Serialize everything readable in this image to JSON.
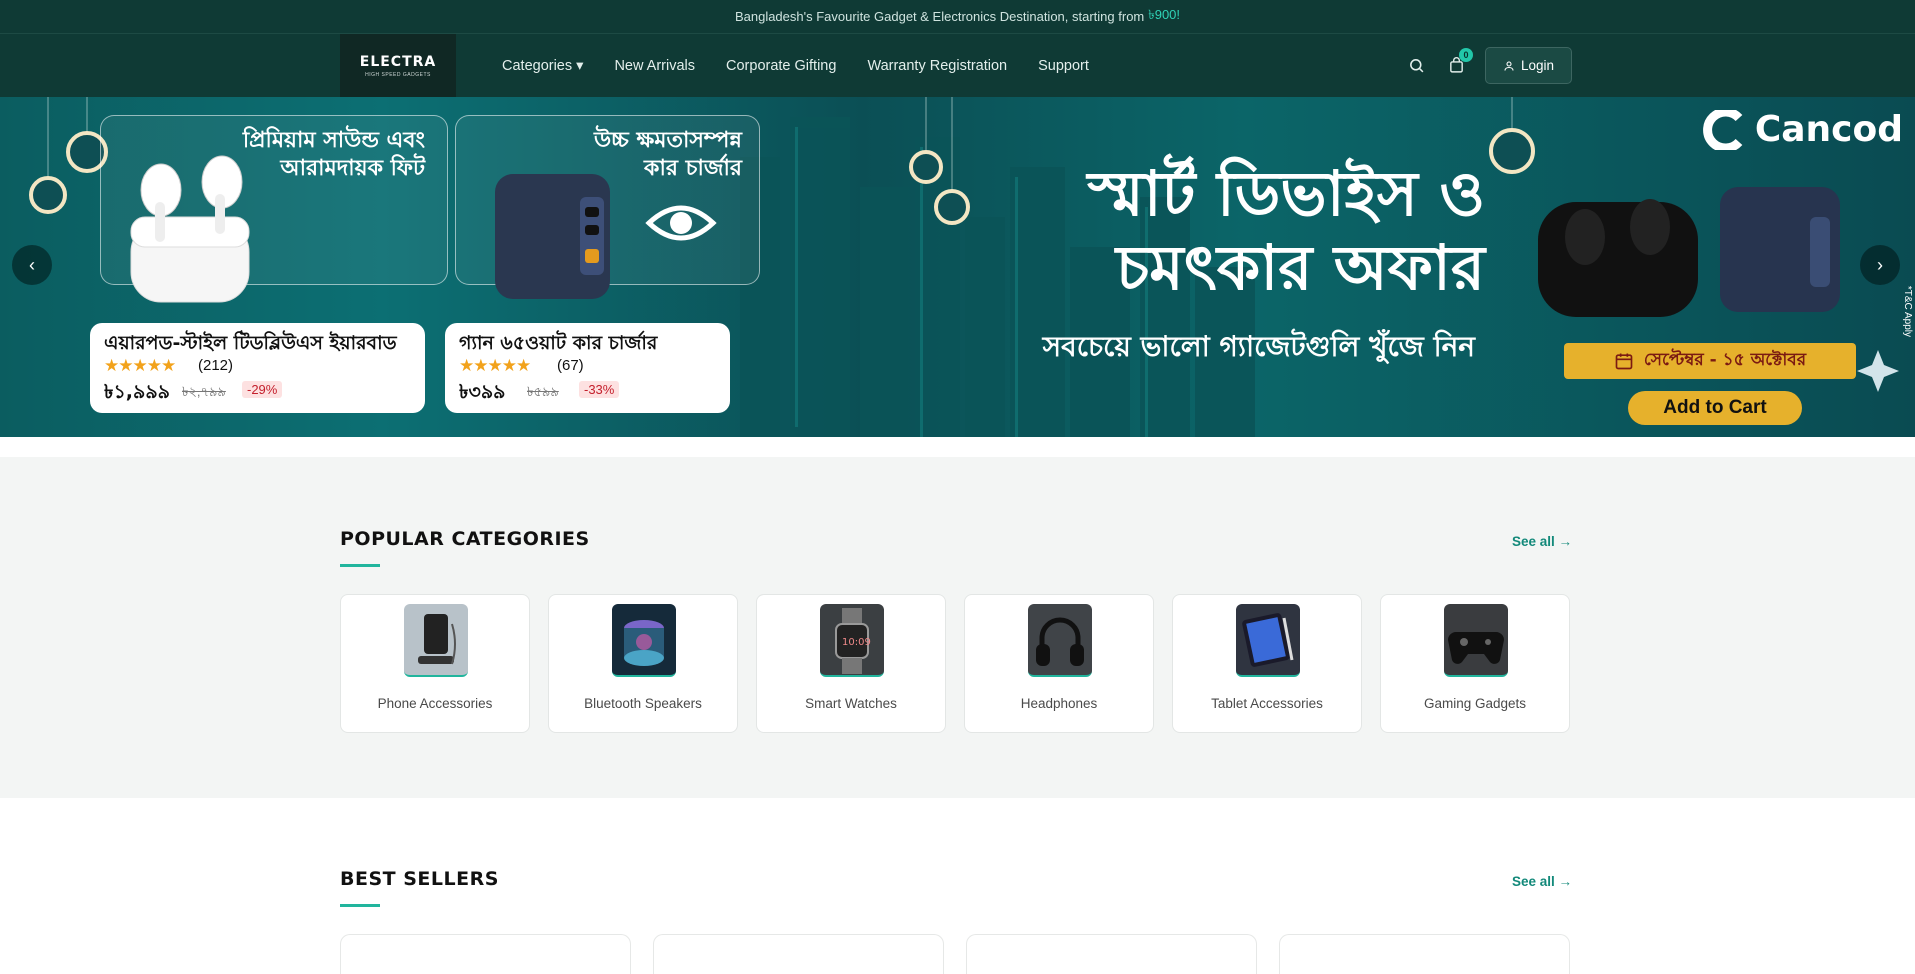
{
  "announcement": {
    "text": "Bangladesh's Favourite Gadget & Electronics Destination, starting from",
    "price": "৳900!"
  },
  "nav": {
    "logo": "ELECTRA",
    "logo_tagline": "HIGH SPEED GADGETS",
    "menu": [
      "Categories ▾",
      "New Arrivals",
      "Corporate Gifting",
      "Warranty Registration",
      "Support"
    ],
    "cart_count": "0",
    "login_label": "Login"
  },
  "hero": {
    "card1": {
      "heading": [
        "প্রিমিয়াম সাউন্ড এবং",
        "আরামদায়ক ফিট"
      ],
      "title": "এয়ারপড-স্টাইল টিডব্লিউএস ইয়ারবাড",
      "rating": 4.5,
      "stars": "★★★★★",
      "reviews": "(212)",
      "price": "৳১,৯৯৯",
      "old_price": "৳২,৭৯৯",
      "discount": "-29%"
    },
    "card2": {
      "heading": [
        "উচ্চ ক্ষমতাসম্পন্ন",
        "কার চার্জার"
      ],
      "title": "গ্যান ৬৫ওয়াট কার চার্জার",
      "rating": 4.5,
      "stars": "★★★★★",
      "reviews": "(67)",
      "price": "৳৩৯৯",
      "old_price": "৳৫৯৯",
      "discount": "-33%"
    },
    "headline_1": "স্মার্ট ডিভাইস ও",
    "headline_2": "চমৎকার অফার",
    "subline": "সবচেয়ে ভালো গ্যাজেটগুলি খুঁজে নিন",
    "brand": "Cancod",
    "date_ribbon": "সেপ্টেম্বর - ১৫ অক্টোবর",
    "cta": "Add to Cart",
    "terms": "*T&C Apply",
    "prev": "‹",
    "next": "›"
  },
  "popular_categories": {
    "title": "POPULAR CATEGORIES",
    "see_all": "See all →",
    "items": [
      {
        "name": "Phone Accessories",
        "icon": "phone-stand-icon"
      },
      {
        "name": "Bluetooth Speakers",
        "icon": "speaker-icon"
      },
      {
        "name": "Smart Watches",
        "icon": "watch-icon"
      },
      {
        "name": "Headphones",
        "icon": "headphones-icon"
      },
      {
        "name": "Tablet Accessories",
        "icon": "tablet-icon"
      },
      {
        "name": "Gaming Gadgets",
        "icon": "gamepad-icon"
      }
    ]
  },
  "best_sellers": {
    "title": "BEST SELLERS",
    "see_all": "See all →"
  },
  "colors": {
    "nav_bg": "#0f3a35",
    "accent": "#21b59d",
    "gold": "#e6b12c"
  }
}
